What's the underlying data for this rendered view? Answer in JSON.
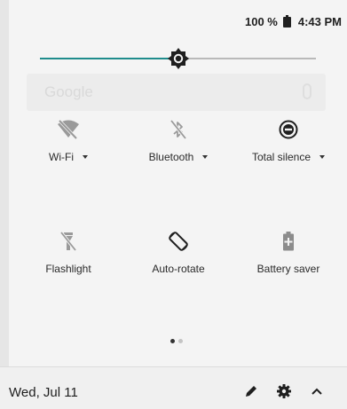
{
  "status_bar": {
    "battery_percent": "100 %",
    "time": "4:43 PM"
  },
  "brightness": {
    "level": 0.5
  },
  "background_search": {
    "placeholder": "Google"
  },
  "tiles": [
    {
      "label": "Wi-Fi",
      "icon": "wifi-off-icon",
      "has_dropdown": true
    },
    {
      "label": "Bluetooth",
      "icon": "bluetooth-off-icon",
      "has_dropdown": true
    },
    {
      "label": "Total silence",
      "icon": "do-not-disturb-icon",
      "has_dropdown": true
    },
    {
      "label": "Flashlight",
      "icon": "flashlight-off-icon",
      "has_dropdown": false
    },
    {
      "label": "Auto-rotate",
      "icon": "auto-rotate-icon",
      "has_dropdown": false
    },
    {
      "label": "Battery saver",
      "icon": "battery-saver-icon",
      "has_dropdown": false
    }
  ],
  "page_indicator": {
    "pages": 2,
    "current": 0,
    "active_color": "#333333",
    "inactive_color": "#c4c4c4"
  },
  "footer": {
    "date": "Wed, Jul 11",
    "edit_icon": "pencil-icon",
    "settings_icon": "gear-icon",
    "collapse_icon": "chevron-up-icon"
  },
  "colors": {
    "accent": "#1f8c8c",
    "panel_bg": "#f4f4f4",
    "icon_dim": "#9a9a9a",
    "icon_dark": "#333333"
  }
}
